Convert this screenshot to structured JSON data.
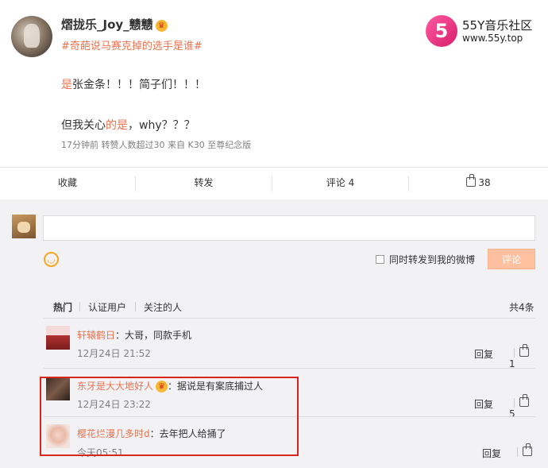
{
  "post": {
    "username": "熠拢乐_Joy_戆戆",
    "topic": "#奇葩说马赛克掉的选手是谁#",
    "line1_hl": "是",
    "line1_rest": "张金条！！！简子们！！！",
    "line2_pre": "但我关心",
    "line2_hl": "的是",
    "line2_post": "，why？？？",
    "meta": "17分钟前  转赞人数超过30  来自 K30 至尊纪念版"
  },
  "watermark": {
    "logo_text": "5",
    "title": "55Y音乐社区",
    "url": "www.55y.top"
  },
  "actions": {
    "favorite": "收藏",
    "repost": "转发",
    "comment": "评论 4",
    "like": "38"
  },
  "compose": {
    "checkbox_label": "同时转发到我的微博",
    "submit": "评论"
  },
  "tabs": [
    "热门",
    "认证用户",
    "关注的人"
  ],
  "total_count": "共4条",
  "comments": [
    {
      "name": "轩辕鹤日",
      "text": "：大哥，同款手机",
      "time": "12月24日 21:52",
      "reply": "回复",
      "likes": "1"
    },
    {
      "name": "东牙是大大地好人",
      "text": "：据说是有案底捕过人",
      "time": "12月24日 23:22",
      "reply": "回复",
      "likes": "5"
    },
    {
      "name": "樱花烂漫几多时d",
      "text": "：去年把人给捅了",
      "time": "今天05:51",
      "reply": "回复",
      "likes": ""
    }
  ],
  "colors": {
    "accent": "#eb7350",
    "highlight_box": "#d9251d"
  }
}
